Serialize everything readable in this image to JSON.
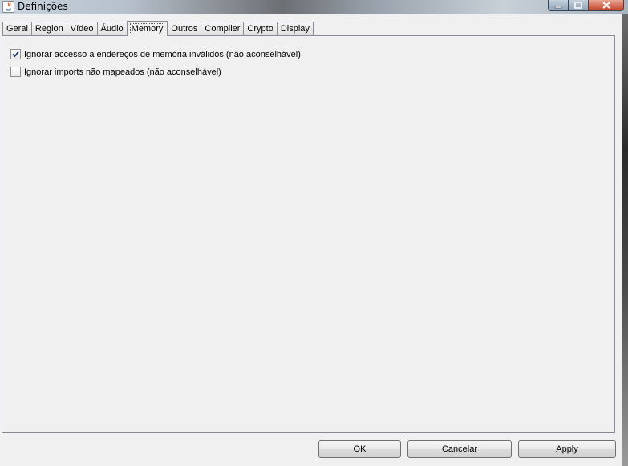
{
  "window": {
    "title": "Definições",
    "app_icon": "java-cup-icon",
    "controls": [
      "minimize-icon",
      "maximize-icon",
      "close-icon"
    ]
  },
  "tabs": [
    {
      "label": "Geral",
      "selected": false
    },
    {
      "label": "Region",
      "selected": false
    },
    {
      "label": "Vídeo",
      "selected": false
    },
    {
      "label": "Áudio",
      "selected": false
    },
    {
      "label": "Memory",
      "selected": true
    },
    {
      "label": "Outros",
      "selected": false
    },
    {
      "label": "Compiler",
      "selected": false
    },
    {
      "label": "Crypto",
      "selected": false
    },
    {
      "label": "Display",
      "selected": false
    }
  ],
  "options": [
    {
      "label": "Ignorar accesso a endereços de memória inválidos (não aconselhável)",
      "checked": true
    },
    {
      "label": "Ignorar imports não mapeados (não aconselhável)",
      "checked": false
    }
  ],
  "buttons": {
    "ok": "OK",
    "cancel": "Cancelar",
    "apply": "Apply"
  }
}
